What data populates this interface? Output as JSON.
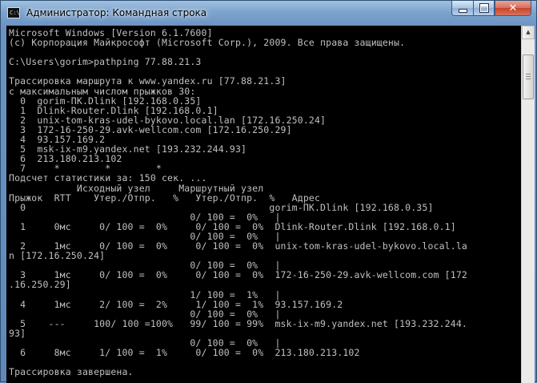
{
  "window": {
    "title": "Администратор: Командная строка",
    "app_icon_label": "C:\\",
    "buttons": {
      "minimize": "minimize-icon",
      "maximize": "maximize-icon",
      "close": "✕"
    }
  },
  "console": {
    "lines": [
      "Microsoft Windows [Version 6.1.7600]",
      "(c) Корпорация Майкрософт (Microsoft Corp.), 2009. Все права защищены.",
      "",
      "C:\\Users\\gorim>pathping 77.88.21.3",
      "",
      "Трассировка маршрута к www.yandex.ru [77.88.21.3]",
      "с максимальным числом прыжков 30:",
      "  0  gorim-ПК.Dlink [192.168.0.35]",
      "  1  Dlink-Router.Dlink [192.168.0.1]",
      "  2  unix-tom-kras-udel-bykovo.local.lan [172.16.250.24]",
      "  3  172-16-250-29.avk-wellcom.com [172.16.250.29]",
      "  4  93.157.169.2",
      "  5  msk-ix-m9.yandex.net [193.232.244.93]",
      "  6  213.180.213.102",
      "  7     *        *        *",
      "Подсчет статистики за: 150 сек. ...",
      "            Исходный узел     Маршрутный узел",
      "Прыжок  RTT    Утер./Отпр.   %   Утер./Отпр.  %   Адрес",
      "  0                                           gorim-ПК.Dlink [192.168.0.35]",
      "                                0/ 100 =  0%   |",
      "  1     0мс     0/ 100 =  0%     0/ 100 =  0%  Dlink-Router.Dlink [192.168.0.1]",
      "                                0/ 100 =  0%   |",
      "  2     1мс     0/ 100 =  0%     0/ 100 =  0%  unix-tom-kras-udel-bykovo.local.la",
      "n [172.16.250.24]",
      "                                0/ 100 =  0%   |",
      "  3     1мс     0/ 100 =  0%     0/ 100 =  0%  172-16-250-29.avk-wellcom.com [172",
      ".16.250.29]",
      "                                1/ 100 =  1%   |",
      "  4     1мс     2/ 100 =  2%     1/ 100 =  1%  93.157.169.2",
      "                                0/ 100 =  0%   |",
      "  5    ---     100/ 100 =100%   99/ 100 = 99%  msk-ix-m9.yandex.net [193.232.244.",
      "93]",
      "                                0/ 100 =  0%   |",
      "  6     8мс     1/ 100 =  1%     0/ 100 =  0%  213.180.213.102",
      "",
      "Трассировка завершена."
    ]
  },
  "scrollbar": {
    "up_arrow": "▲",
    "position": 0.08
  }
}
